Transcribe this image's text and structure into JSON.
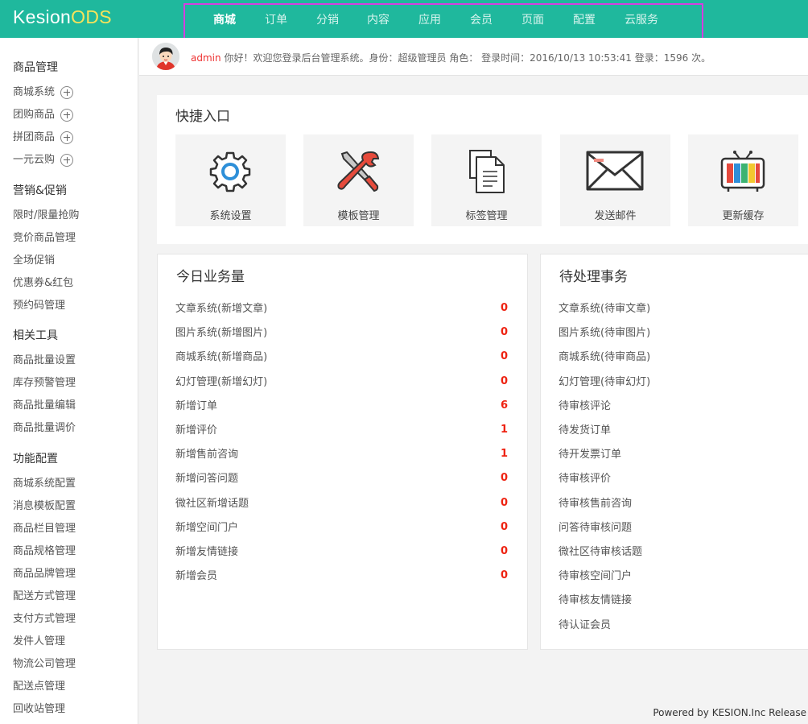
{
  "logo": {
    "main": "Kesion",
    "accent": "ODS"
  },
  "nav": [
    "商城",
    "订单",
    "分销",
    "内容",
    "应用",
    "会员",
    "页面",
    "配置",
    "云服务"
  ],
  "sidebar": {
    "groups": [
      {
        "title": "商品管理",
        "items": [
          {
            "label": "商城系统",
            "expand": true
          },
          {
            "label": "团购商品",
            "expand": true
          },
          {
            "label": "拼团商品",
            "expand": true
          },
          {
            "label": "一元云购",
            "expand": true
          }
        ]
      },
      {
        "title": "营销&促销",
        "items": [
          {
            "label": "限时/限量抢购"
          },
          {
            "label": "竞价商品管理"
          },
          {
            "label": "全场促销"
          },
          {
            "label": "优惠券&红包"
          },
          {
            "label": "预约码管理"
          }
        ]
      },
      {
        "title": "相关工具",
        "items": [
          {
            "label": "商品批量设置"
          },
          {
            "label": "库存预警管理"
          },
          {
            "label": "商品批量编辑"
          },
          {
            "label": "商品批量调价"
          }
        ]
      },
      {
        "title": "功能配置",
        "items": [
          {
            "label": "商城系统配置"
          },
          {
            "label": "消息模板配置"
          },
          {
            "label": "商品栏目管理"
          },
          {
            "label": "商品规格管理"
          },
          {
            "label": "商品品牌管理"
          },
          {
            "label": "配送方式管理"
          },
          {
            "label": "支付方式管理"
          },
          {
            "label": "发件人管理"
          },
          {
            "label": "物流公司管理"
          },
          {
            "label": "配送点管理"
          },
          {
            "label": "回收站管理"
          }
        ]
      }
    ]
  },
  "welcome": {
    "username": "admin",
    "message": "你好！欢迎您登录后台管理系统。身份：超级管理员 角色： 登录时间：2016/10/13 10:53:41 登录：1596 次。"
  },
  "quick": {
    "title": "快捷入口",
    "items": [
      {
        "label": "系统设置",
        "icon": "gear-icon"
      },
      {
        "label": "模板管理",
        "icon": "tools-icon"
      },
      {
        "label": "标签管理",
        "icon": "documents-icon"
      },
      {
        "label": "发送邮件",
        "icon": "envelope-icon"
      },
      {
        "label": "更新缓存",
        "icon": "tv-icon"
      }
    ]
  },
  "today": {
    "title": "今日业务量",
    "rows": [
      {
        "label": "文章系统(新增文章)",
        "value": "0"
      },
      {
        "label": "图片系统(新增图片)",
        "value": "0"
      },
      {
        "label": "商城系统(新增商品)",
        "value": "0"
      },
      {
        "label": "幻灯管理(新增幻灯)",
        "value": "0"
      },
      {
        "label": "新增订单",
        "value": "6"
      },
      {
        "label": "新增评价",
        "value": "1"
      },
      {
        "label": "新增售前咨询",
        "value": "1"
      },
      {
        "label": "新增问答问题",
        "value": "0"
      },
      {
        "label": "微社区新增话题",
        "value": "0"
      },
      {
        "label": "新增空间门户",
        "value": "0"
      },
      {
        "label": "新增友情链接",
        "value": "0"
      },
      {
        "label": "新增会员",
        "value": "0"
      }
    ]
  },
  "pending": {
    "title": "待处理事务",
    "rows": [
      "文章系统(待审文章)",
      "图片系统(待审图片)",
      "商城系统(待审商品)",
      "幻灯管理(待审幻灯)",
      "待审核评论",
      "待发货订单",
      "待开发票订单",
      "待审核评价",
      "待审核售前咨询",
      "问答待审核问题",
      "微社区待审核话题",
      "待审核空间门户",
      "待审核友情链接",
      "待认证会员"
    ]
  },
  "footer": "Powered by KESION.Inc Release"
}
